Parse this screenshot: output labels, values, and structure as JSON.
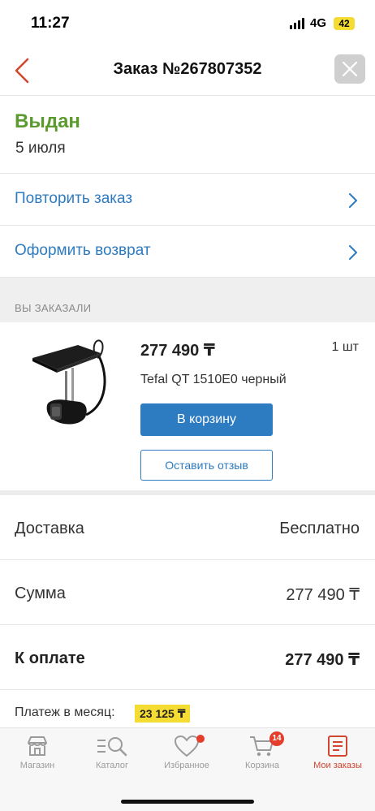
{
  "status_bar": {
    "time": "11:27",
    "network": "4G",
    "battery": "42"
  },
  "header": {
    "title": "Заказ №267807352",
    "back_icon": "chevron-left-icon",
    "close_icon": "close-icon"
  },
  "order": {
    "status": "Выдан",
    "date": "5 июля",
    "status_color": "#5b9b2e"
  },
  "actions": [
    {
      "label": "Повторить заказ"
    },
    {
      "label": "Оформить возврат"
    }
  ],
  "section": {
    "ordered_label": "ВЫ ЗАКАЗАЛИ"
  },
  "product": {
    "price": "277 490 ₸",
    "quantity": "1 шт",
    "name": "Tefal QT 1510E0 черный",
    "cart_button": "В корзину",
    "review_button": "Оставить отзыв"
  },
  "summary": {
    "delivery": {
      "label": "Доставка",
      "value": "Бесплатно"
    },
    "sum": {
      "label": "Сумма",
      "value": "277 490 ₸"
    },
    "to_pay": {
      "label": "К оплате",
      "value": "277 490 ₸"
    }
  },
  "installment": {
    "label": "Платеж в месяц:",
    "value": "23 125 ₸"
  },
  "tabs": [
    {
      "label": "Магазин",
      "icon": "store-icon"
    },
    {
      "label": "Каталог",
      "icon": "catalog-search-icon"
    },
    {
      "label": "Избранное",
      "icon": "heart-icon"
    },
    {
      "label": "Корзина",
      "icon": "cart-icon",
      "badge": "14"
    },
    {
      "label": "Мои заказы",
      "icon": "orders-icon",
      "active": true
    }
  ],
  "colors": {
    "accent_blue": "#2d7bc0",
    "accent_red": "#d2452f",
    "highlight_yellow": "#f5dc32"
  }
}
